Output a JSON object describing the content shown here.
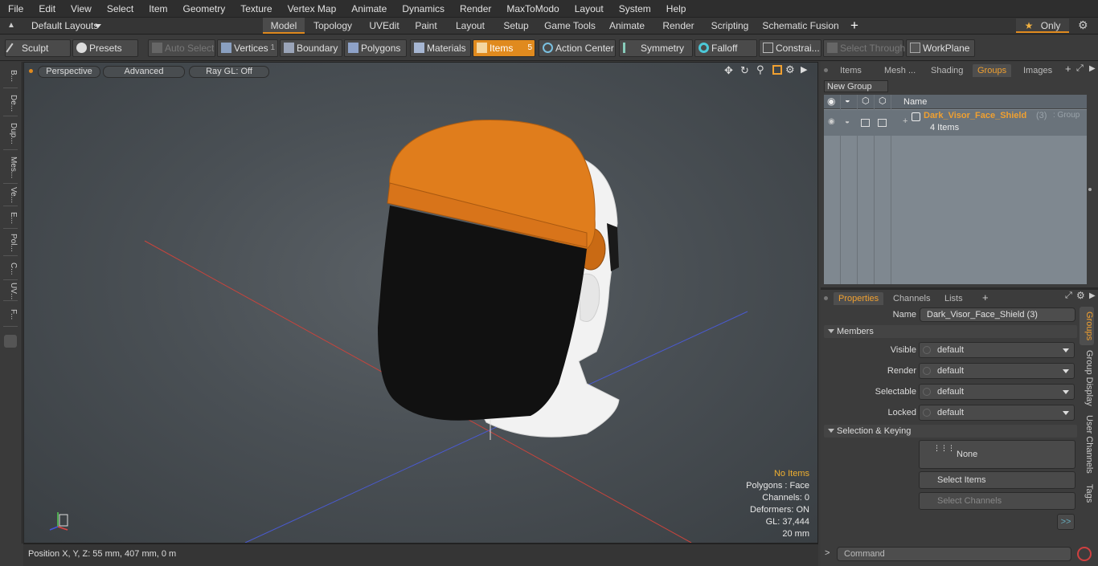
{
  "menu": [
    "File",
    "Edit",
    "View",
    "Select",
    "Item",
    "Geometry",
    "Texture",
    "Vertex Map",
    "Animate",
    "Dynamics",
    "Render",
    "MaxToModo",
    "Layout",
    "System",
    "Help"
  ],
  "layouts_label": "Default Layouts",
  "layout_tabs": [
    "Model",
    "Topology",
    "UVEdit",
    "Paint",
    "Layout",
    "Setup",
    "Game Tools",
    "Animate",
    "Render",
    "Scripting",
    "Schematic Fusion"
  ],
  "only_label": "Only",
  "toolbar": {
    "sculpt": "Sculpt",
    "presets": "Presets",
    "auto_select": "Auto Select",
    "vertices": "Vertices",
    "vertices_count": "1",
    "boundary": "Boundary",
    "polygons": "Polygons",
    "materials": "Materials",
    "items": "Items",
    "items_count": "5",
    "action_center": "Action Center",
    "symmetry": "Symmetry",
    "falloff": "Falloff",
    "constraints": "Constrai...",
    "select_through": "Select Through",
    "workplane": "WorkPlane"
  },
  "left_tabs": [
    "B...",
    "De...",
    "Dup...",
    "Mes...",
    "Ve...",
    "E...",
    "Pol...",
    "C...",
    "UV...",
    "F..."
  ],
  "viewport": {
    "perspective": "Perspective",
    "advanced": "Advanced",
    "raygl": "Ray GL: Off"
  },
  "stats": {
    "items": "No Items",
    "polygons": "Polygons : Face",
    "channels": "Channels: 0",
    "deformers": "Deformers: ON",
    "gl": "GL: 37,444",
    "size": "20 mm"
  },
  "status": {
    "position": "Position X, Y, Z:  55 mm, 407 mm, 0 m"
  },
  "right_tabs": [
    "Items",
    "Mesh ...",
    "Shading",
    "Groups",
    "Images"
  ],
  "new_group": "New Group",
  "list_header": "Name",
  "group": {
    "name": "Dark_Visor_Face_Shield",
    "count": "(3)",
    "type": ": Group",
    "items": "4 Items"
  },
  "props_tabs": [
    "Properties",
    "Channels",
    "Lists"
  ],
  "props": {
    "name_label": "Name",
    "name_value": "Dark_Visor_Face_Shield (3)",
    "members": "Members",
    "visible_label": "Visible",
    "visible_value": "default",
    "render_label": "Render",
    "render_value": "default",
    "selectable_label": "Selectable",
    "selectable_value": "default",
    "locked_label": "Locked",
    "locked_value": "default",
    "selection_keying": "Selection & Keying",
    "none_label": "None",
    "select_items": "Select Items",
    "select_channels": "Select Channels",
    "more": ">>"
  },
  "side_tabs": [
    "Groups",
    "Group Display",
    "User Channels",
    "Tags"
  ],
  "command_placeholder": "Command",
  "colors": {
    "accent": "#e08a1e",
    "helmet": "#e07d1c",
    "visor": "#111111"
  }
}
